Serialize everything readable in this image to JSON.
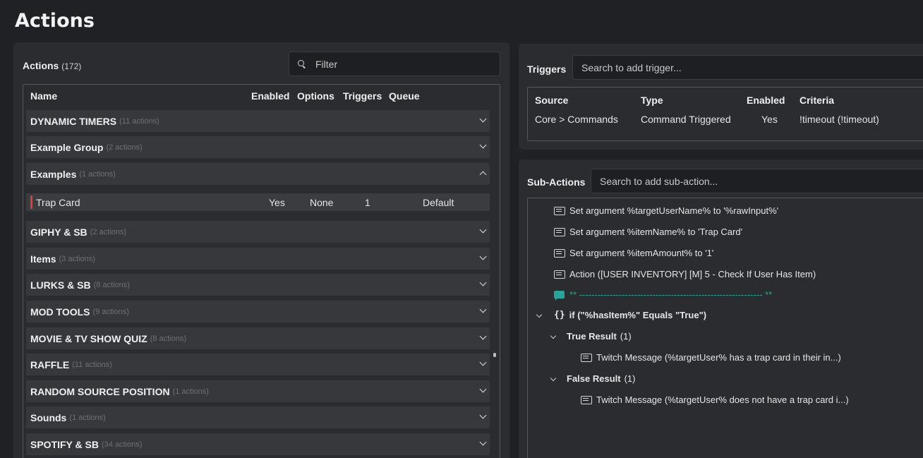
{
  "page_title": "Actions",
  "actions_panel": {
    "label": "Actions",
    "count": "(172)",
    "filter_placeholder": "Filter",
    "columns": [
      "Name",
      "Enabled",
      "Options",
      "Triggers",
      "Queue"
    ],
    "groups": [
      {
        "name": "DYNAMIC TIMERS",
        "count": "(11 actions)",
        "expanded": false
      },
      {
        "name": "Example Group",
        "count": "(2 actions)",
        "expanded": false
      },
      {
        "name": "Examples",
        "count": "(1 actions)",
        "expanded": true
      },
      {
        "name": "GIPHY & SB",
        "count": "(2 actions)",
        "expanded": false
      },
      {
        "name": "Items",
        "count": "(3 actions)",
        "expanded": false
      },
      {
        "name": "LURKS & SB",
        "count": "(8 actions)",
        "expanded": false
      },
      {
        "name": "MOD TOOLS",
        "count": "(9 actions)",
        "expanded": false
      },
      {
        "name": "MOVIE & TV SHOW QUIZ",
        "count": "(8 actions)",
        "expanded": false
      },
      {
        "name": "RAFFLE",
        "count": "(11 actions)",
        "expanded": false
      },
      {
        "name": "RANDOM SOURCE POSITION",
        "count": "(1 actions)",
        "expanded": false
      },
      {
        "name": "Sounds",
        "count": "(1 actions)",
        "expanded": false
      },
      {
        "name": "SPOTIFY & SB",
        "count": "(34 actions)",
        "expanded": false
      }
    ],
    "selected_action": {
      "name": "Trap Card",
      "enabled": "Yes",
      "options": "None",
      "triggers": "1",
      "queue": "Default"
    }
  },
  "triggers_panel": {
    "label": "Triggers",
    "search_placeholder": "Search to add trigger...",
    "columns": [
      "Source",
      "Type",
      "Enabled",
      "Criteria"
    ],
    "rows": [
      {
        "source": "Core > Commands",
        "type": "Command Triggered",
        "enabled": "Yes",
        "criteria": "!timeout (!timeout)"
      }
    ]
  },
  "subactions_panel": {
    "label": "Sub-Actions",
    "search_placeholder": "Search to add sub-action...",
    "items": [
      {
        "text": "Set argument %targetUserName% to '%rawInput%'",
        "icon": "list-icon"
      },
      {
        "text": "Set argument %itemName% to 'Trap Card'",
        "icon": "list-icon"
      },
      {
        "text": "Set argument %itemAmount% to '1'",
        "icon": "list-icon"
      },
      {
        "text": "Action ([USER INVENTORY] [M] 5 - Check If User Has Item)",
        "icon": "list-icon"
      },
      {
        "text": "** ------------------------------------------------------------ **",
        "icon": "comment-icon"
      },
      {
        "text": "if (\"%hasItem%\" Equals \"True\")",
        "icon": "brace-icon"
      },
      {
        "text": "True Result",
        "count": "(1)"
      },
      {
        "text": "Twitch Message (%targetUser% has a trap card in their in...)",
        "icon": "list-icon"
      },
      {
        "text": "False Result",
        "count": "(1)"
      },
      {
        "text": "Twitch Message (%targetUser% does not have a trap card i...)",
        "icon": "list-icon"
      }
    ]
  }
}
